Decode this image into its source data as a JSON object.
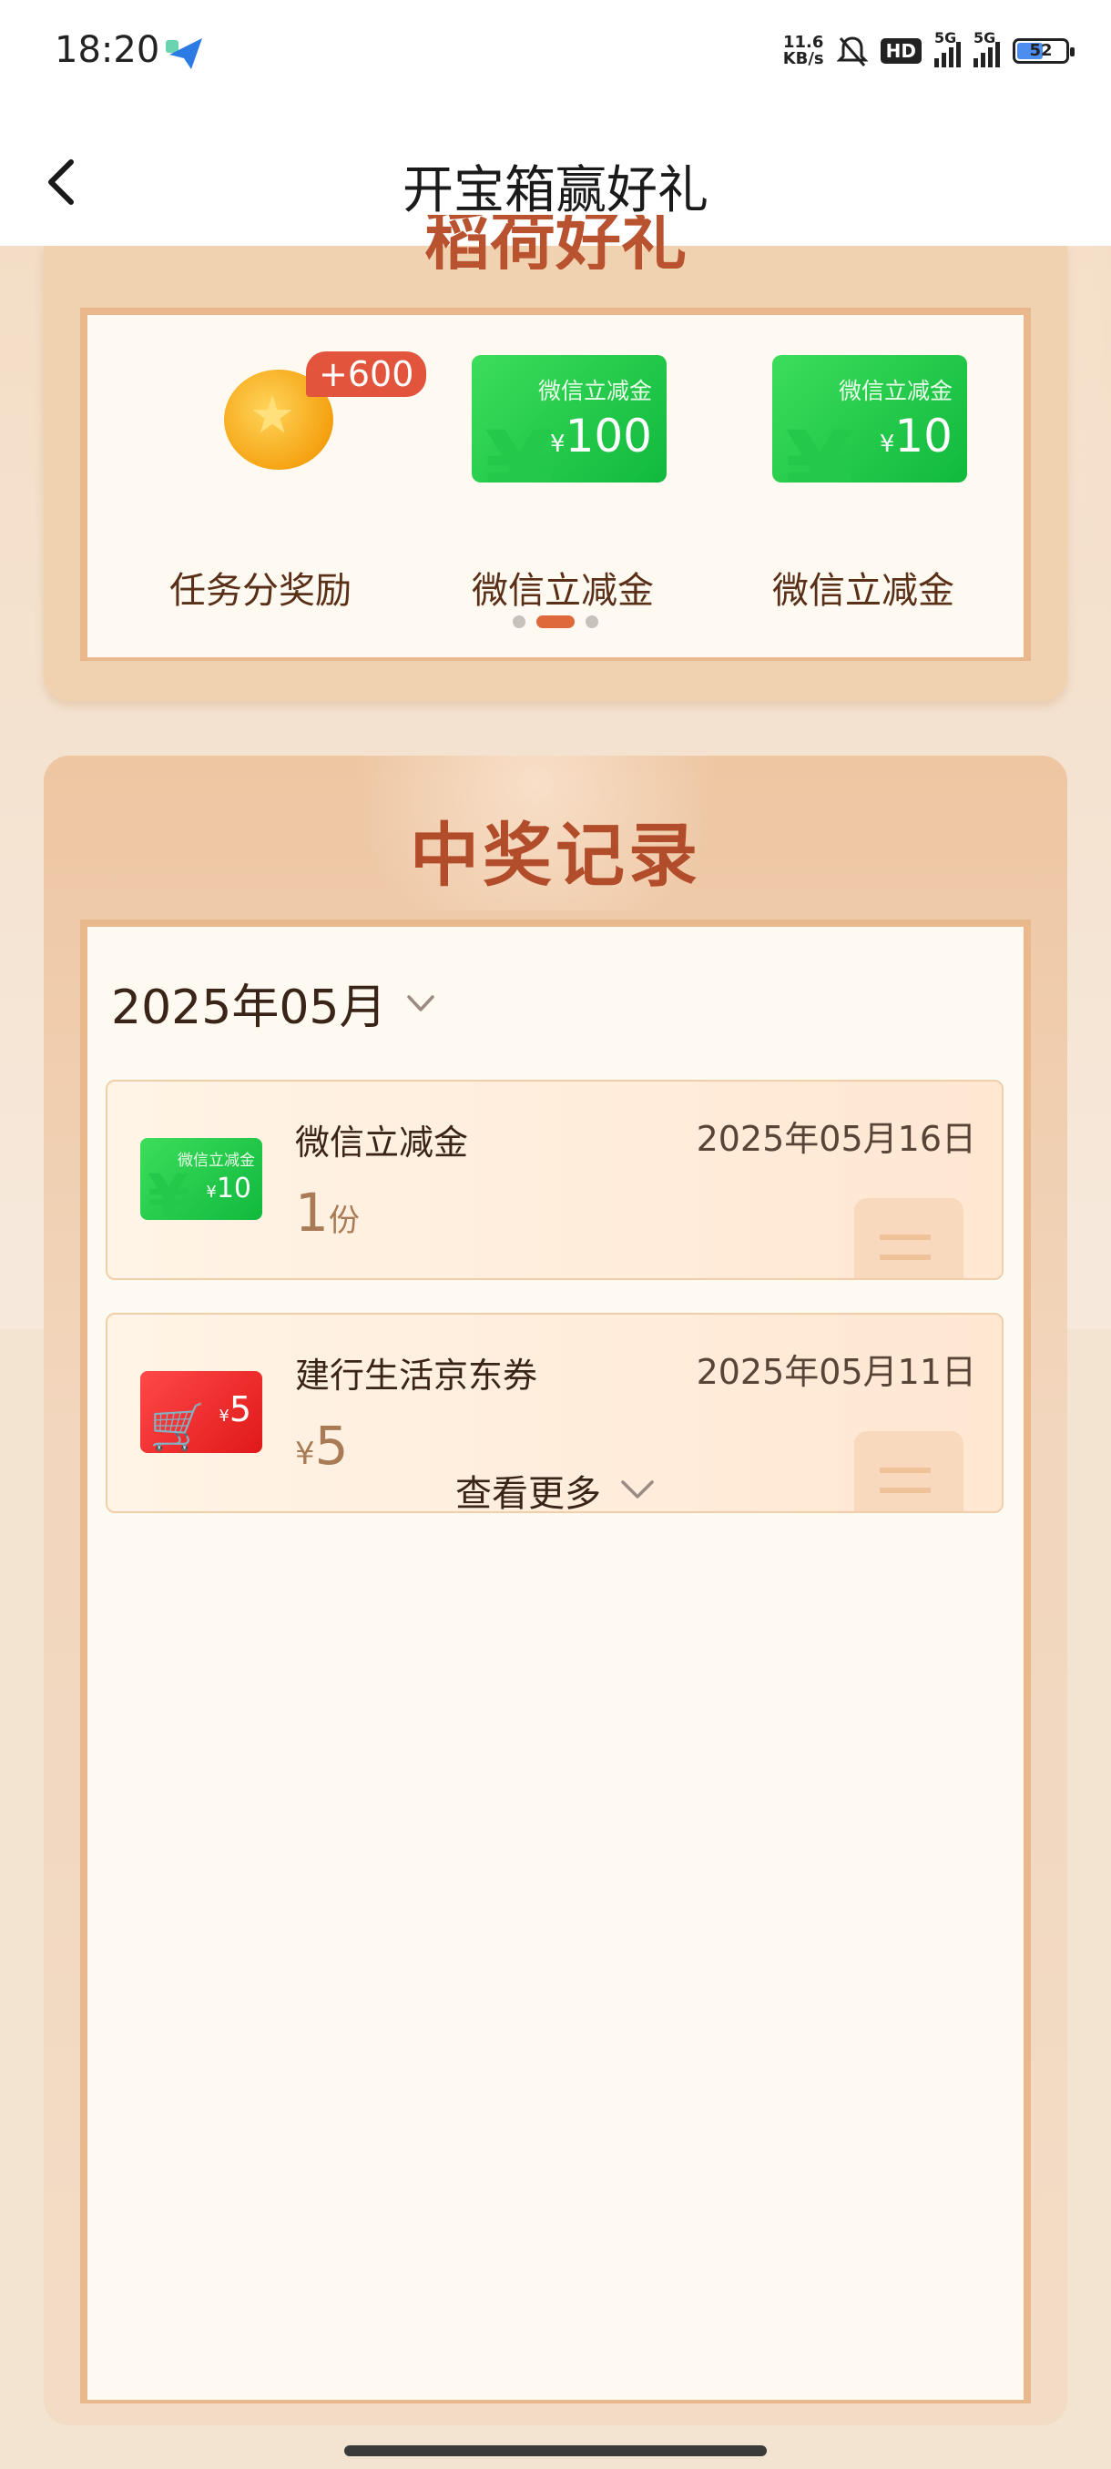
{
  "status_bar": {
    "time": "18:20",
    "net_speed_value": "11.6",
    "net_speed_unit": "KB/s",
    "hd_label": "HD",
    "signal1_label": "5G",
    "signal2_label": "5G",
    "battery": "52",
    "icons": [
      "app-send-icon",
      "mute-bell-icon",
      "hd-icon",
      "signal-icon",
      "signal-icon",
      "battery-icon"
    ]
  },
  "nav": {
    "title": "开宝箱赢好礼",
    "back_icon": "chevron-left-icon"
  },
  "prize_card": {
    "title_partial": "稻荷好礼",
    "prizes": [
      {
        "label": "任务分奖励",
        "badge": "+600",
        "icon": "gold-coin-icon"
      },
      {
        "label": "微信立减金",
        "voucher_title": "微信立减金",
        "currency": "¥",
        "amount": "100"
      },
      {
        "label": "微信立减金",
        "voucher_title": "微信立减金",
        "currency": "¥",
        "amount": "10"
      }
    ],
    "pager": {
      "total": 3,
      "active": 1
    }
  },
  "records_card": {
    "title": "中奖记录",
    "month": "2025年05月",
    "records": [
      {
        "name": "微信立减金",
        "date": "2025年05月16日",
        "amount": "1",
        "unit": "份",
        "thumb_title": "微信立减金",
        "thumb_currency": "¥",
        "thumb_amount": "10"
      },
      {
        "name": "建行生活京东券",
        "date": "2025年05月11日",
        "amount": "5",
        "currency": "¥",
        "thumb_currency": "¥",
        "thumb_amount": "5"
      }
    ],
    "view_more": "查看更多"
  }
}
